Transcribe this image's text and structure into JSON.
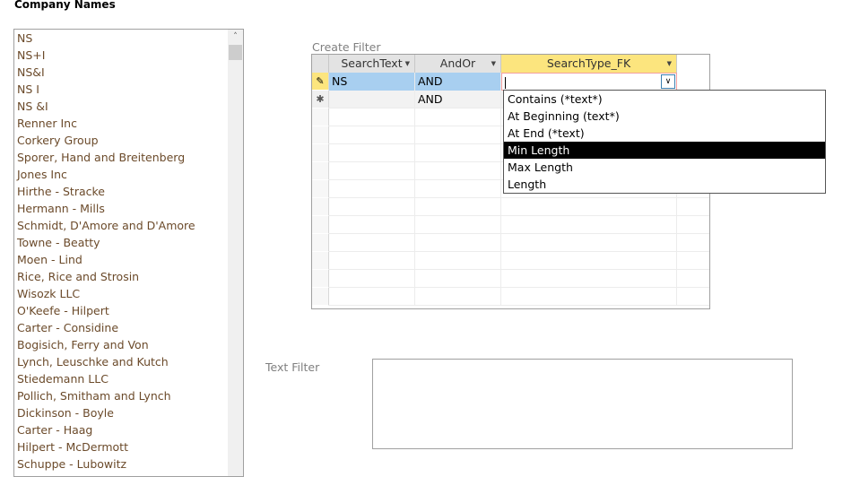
{
  "company_names": {
    "title": "Company Names",
    "items": [
      "NS",
      "NS+I",
      "NS&I",
      "NS I",
      "NS &I",
      "Renner Inc",
      "Corkery Group",
      "Sporer, Hand and Breitenberg",
      "Jones Inc",
      "Hirthe - Stracke",
      "Hermann - Mills",
      "Schmidt, D'Amore and D'Amore",
      "Towne - Beatty",
      "Moen - Lind",
      "Rice, Rice and Strosin",
      "Wisozk LLC",
      "O'Keefe - Hilpert",
      "Carter - Considine",
      "Bogisich, Ferry and Von",
      "Lynch, Leuschke and Kutch",
      "Stiedemann LLC",
      "Pollich, Smitham and Lynch",
      "Dickinson - Boyle",
      "Carter - Haag",
      "Hilpert - McDermott",
      "Schuppe - Lubowitz"
    ]
  },
  "create_filter": {
    "label": "Create Filter",
    "columns": [
      "SearchText",
      "AndOr",
      "SearchType_FK"
    ],
    "rows": [
      {
        "selector": "pencil-icon",
        "search_text": "NS",
        "and_or": "AND",
        "search_type": ""
      },
      {
        "selector": "new-record-icon",
        "search_text": "",
        "and_or": "AND",
        "search_type": ""
      }
    ],
    "dropdown": {
      "options": [
        "Contains (*text*)",
        "At Beginning (text*)",
        "At End (*text)",
        "Min Length",
        "Max Length",
        "Length"
      ],
      "highlighted": "Min Length"
    }
  },
  "text_filter": {
    "label": "Text Filter",
    "value": ""
  }
}
